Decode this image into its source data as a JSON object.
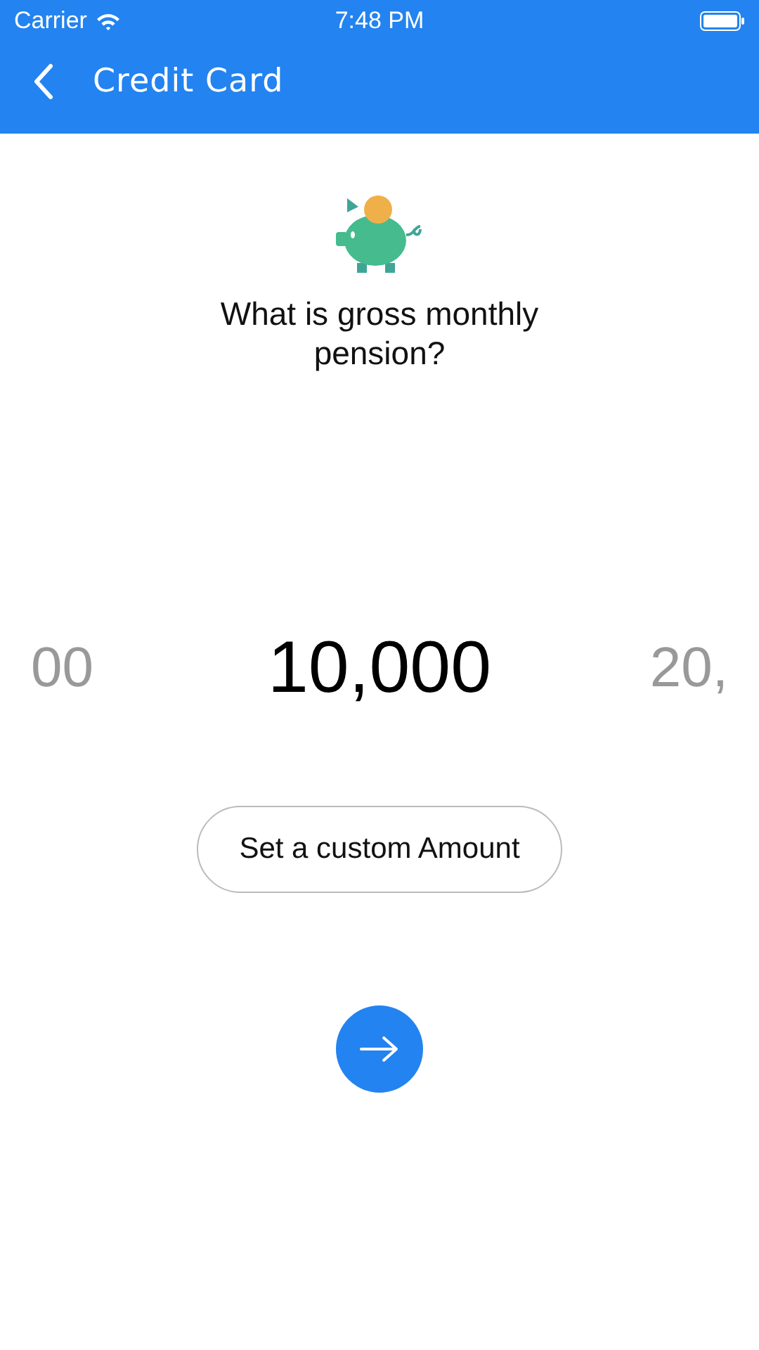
{
  "status_bar": {
    "carrier": "Carrier",
    "time": "7:48 PM"
  },
  "nav_bar": {
    "title": "Credit Card"
  },
  "question": "What is gross monthly pension?",
  "picker": [
    {
      "label": "00",
      "selected": false
    },
    {
      "label": "10,000",
      "selected": true
    },
    {
      "label": "20,",
      "selected": false
    }
  ],
  "custom_button": "Set a custom Amount"
}
